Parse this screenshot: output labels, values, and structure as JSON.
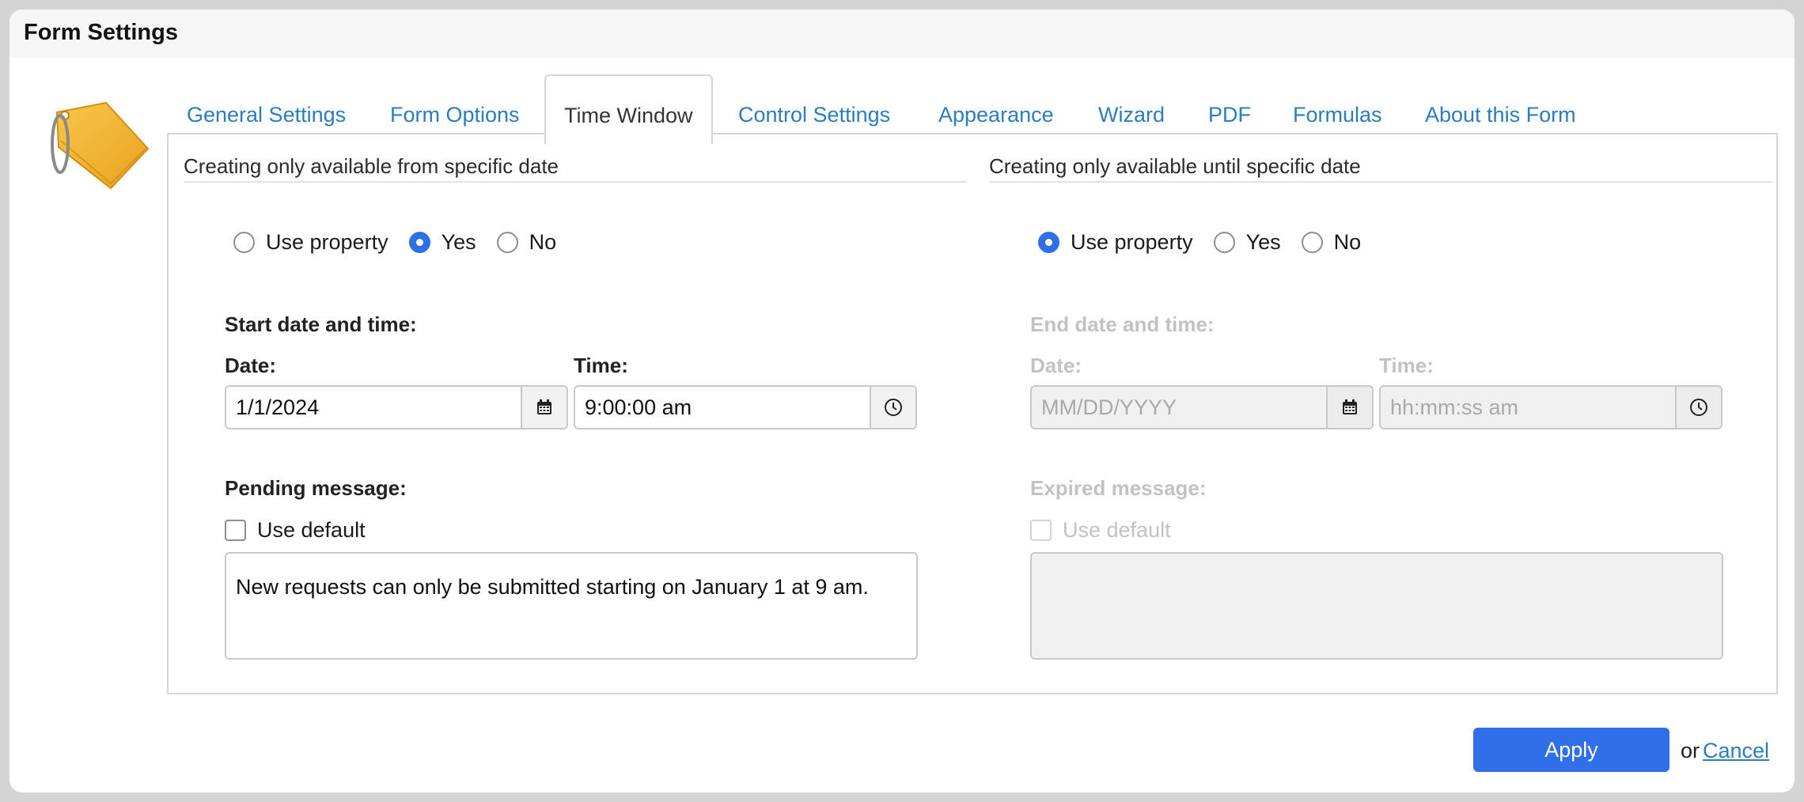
{
  "window": {
    "title": "Form Settings"
  },
  "tabs": [
    {
      "label": "General Settings"
    },
    {
      "label": "Form Options"
    },
    {
      "label": "Time Window"
    },
    {
      "label": "Control Settings"
    },
    {
      "label": "Appearance"
    },
    {
      "label": "Wizard"
    },
    {
      "label": "PDF"
    },
    {
      "label": "Formulas"
    },
    {
      "label": "About this Form"
    }
  ],
  "active_tab": "Time Window",
  "start": {
    "section_title": "Creating only available from specific date",
    "radio_options": [
      "Use property",
      "Yes",
      "No"
    ],
    "radio_selected": "Yes",
    "datetime_heading": "Start date and time:",
    "date_label": "Date:",
    "date_value": "1/1/2024",
    "time_label": "Time:",
    "time_value": "9:00:00 am",
    "message_label": "Pending message:",
    "use_default_label": "Use default",
    "use_default_checked": false,
    "message_text": "New requests can only be submitted starting on January 1 at 9 am."
  },
  "end": {
    "section_title": "Creating only available until specific date",
    "radio_options": [
      "Use property",
      "Yes",
      "No"
    ],
    "radio_selected": "Use property",
    "datetime_heading": "End date and time:",
    "date_label": "Date:",
    "date_placeholder": "MM/DD/YYYY",
    "time_label": "Time:",
    "time_placeholder": "hh:mm:ss am",
    "message_label": "Expired message:",
    "use_default_label": "Use default",
    "use_default_checked": false,
    "message_text": ""
  },
  "footer": {
    "apply_label": "Apply",
    "or_text": "or",
    "cancel_label": "Cancel"
  },
  "colors": {
    "accent": "#2f6fe8",
    "link": "#2a7cc4",
    "disabled_text": "#c2c2c2"
  }
}
